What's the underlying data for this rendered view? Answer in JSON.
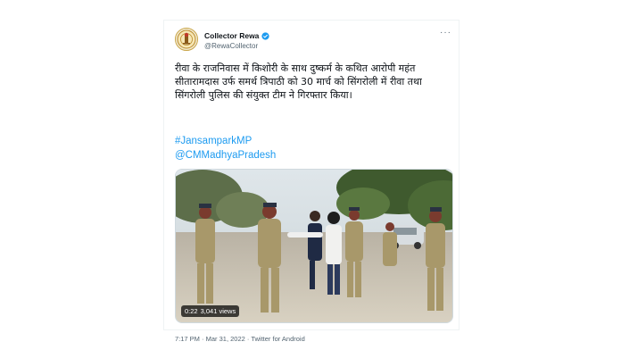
{
  "tweet": {
    "author": {
      "display_name": "Collector Rewa",
      "handle": "@RewaCollector",
      "verified": true,
      "avatar_icon": "government-emblem-icon"
    },
    "more_label": "···",
    "text": "रीवा के राजनिवास में किशोरी के साथ दुष्कर्म के कथित आरोपी महंत सीतारामदास उर्फ समर्थ त्रिपाठी को 30 मार्च को सिंगरोली में रीवा तथा सिंगरोली पुलिस की संयुक्त टीम ने गिरफ्तार किया।",
    "hashtags": [
      "#JansamparkMP",
      "@CMMadhyaPradesh"
    ],
    "video": {
      "duration": "0:22",
      "views": "3,041 views"
    },
    "footer": "7:17 PM · Mar 31, 2022 · Twitter for Android"
  },
  "colors": {
    "link": "#1d9bf0",
    "verified": "#1d9bf0",
    "secondary_text": "#536471"
  }
}
